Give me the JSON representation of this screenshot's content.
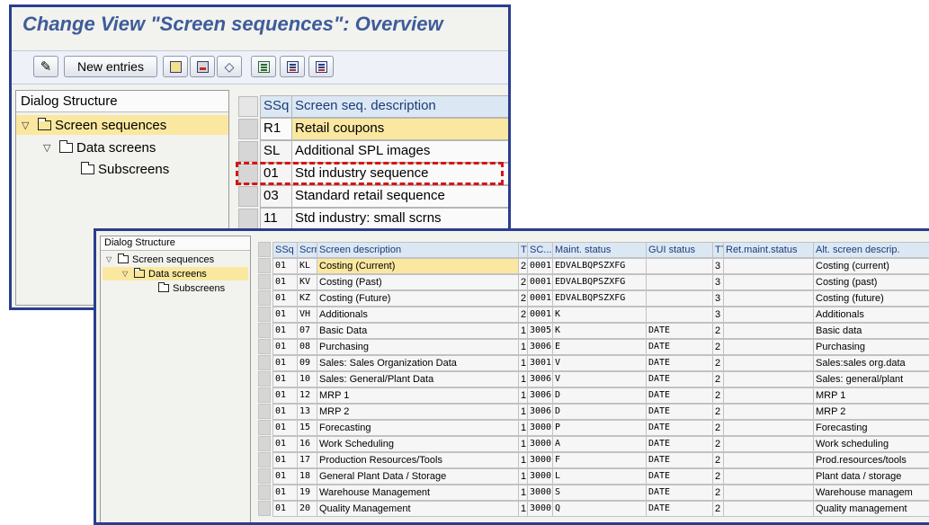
{
  "back_window": {
    "title": "Change View \"Screen sequences\": Overview",
    "toolbar": {
      "new_entries": "New entries"
    },
    "dialog": {
      "header": "Dialog Structure",
      "nodes": {
        "screen_sequences": "Screen sequences",
        "data_screens": "Data screens",
        "subscreens": "Subscreens"
      }
    },
    "table": {
      "headers": {
        "ssq": "SSq",
        "desc": "Screen seq. description"
      },
      "rows": [
        {
          "ssq": "R1",
          "desc": "Retail coupons"
        },
        {
          "ssq": "SL",
          "desc": "Additional SPL images"
        },
        {
          "ssq": "01",
          "desc": "Std industry sequence"
        },
        {
          "ssq": "03",
          "desc": "Standard retail sequence"
        },
        {
          "ssq": "11",
          "desc": "Std industry: small scrns"
        }
      ]
    }
  },
  "front_window": {
    "dialog": {
      "header": "Dialog Structure",
      "nodes": {
        "screen_sequences": "Screen sequences",
        "data_screens": "Data screens",
        "subscreens": "Subscreens"
      }
    },
    "table": {
      "headers": {
        "ssq": "SSq",
        "scrn": "Scrn",
        "desc": "Screen description",
        "t": "T",
        "sc": "SC...",
        "maint": "Maint. status",
        "gui": "GUI status",
        "tt": "TT",
        "ret": "Ret.maint.status",
        "alt": "Alt. screen descrip."
      },
      "rows": [
        {
          "ssq": "01",
          "scrn": "KL",
          "desc": "Costing (Current)",
          "t": "2",
          "sc": "0001",
          "maint": "EDVALBQPSZXFG",
          "gui": "",
          "tt": "3",
          "ret": "",
          "alt": "Costing (current)"
        },
        {
          "ssq": "01",
          "scrn": "KV",
          "desc": "Costing (Past)",
          "t": "2",
          "sc": "0001",
          "maint": "EDVALBQPSZXFG",
          "gui": "",
          "tt": "3",
          "ret": "",
          "alt": "Costing (past)"
        },
        {
          "ssq": "01",
          "scrn": "KZ",
          "desc": "Costing (Future)",
          "t": "2",
          "sc": "0001",
          "maint": "EDVALBQPSZXFG",
          "gui": "",
          "tt": "3",
          "ret": "",
          "alt": "Costing (future)"
        },
        {
          "ssq": "01",
          "scrn": "VH",
          "desc": "Additionals",
          "t": "2",
          "sc": "0001",
          "maint": "K",
          "gui": "",
          "tt": "3",
          "ret": "",
          "alt": "Additionals"
        },
        {
          "ssq": "01",
          "scrn": "07",
          "desc": "Basic Data",
          "t": "1",
          "sc": "3005",
          "maint": "K",
          "gui": "DATE",
          "tt": "2",
          "ret": "",
          "alt": "Basic data"
        },
        {
          "ssq": "01",
          "scrn": "08",
          "desc": "Purchasing",
          "t": "1",
          "sc": "3006",
          "maint": "E",
          "gui": "DATE",
          "tt": "2",
          "ret": "",
          "alt": "Purchasing"
        },
        {
          "ssq": "01",
          "scrn": "09",
          "desc": "Sales: Sales Organization Data",
          "t": "1",
          "sc": "3001",
          "maint": "V",
          "gui": "DATE",
          "tt": "2",
          "ret": "",
          "alt": "Sales:sales org.data"
        },
        {
          "ssq": "01",
          "scrn": "10",
          "desc": "Sales: General/Plant Data",
          "t": "1",
          "sc": "3006",
          "maint": "V",
          "gui": "DATE",
          "tt": "2",
          "ret": "",
          "alt": "Sales: general/plant"
        },
        {
          "ssq": "01",
          "scrn": "12",
          "desc": "MRP 1",
          "t": "1",
          "sc": "3006",
          "maint": "D",
          "gui": "DATE",
          "tt": "2",
          "ret": "",
          "alt": "MRP 1"
        },
        {
          "ssq": "01",
          "scrn": "13",
          "desc": "MRP 2",
          "t": "1",
          "sc": "3006",
          "maint": "D",
          "gui": "DATE",
          "tt": "2",
          "ret": "",
          "alt": "MRP 2"
        },
        {
          "ssq": "01",
          "scrn": "15",
          "desc": "Forecasting",
          "t": "1",
          "sc": "3000",
          "maint": "P",
          "gui": "DATE",
          "tt": "2",
          "ret": "",
          "alt": "Forecasting"
        },
        {
          "ssq": "01",
          "scrn": "16",
          "desc": "Work Scheduling",
          "t": "1",
          "sc": "3000",
          "maint": "A",
          "gui": "DATE",
          "tt": "2",
          "ret": "",
          "alt": "Work scheduling"
        },
        {
          "ssq": "01",
          "scrn": "17",
          "desc": "Production Resources/Tools",
          "t": "1",
          "sc": "3000",
          "maint": "F",
          "gui": "DATE",
          "tt": "2",
          "ret": "",
          "alt": "Prod.resources/tools"
        },
        {
          "ssq": "01",
          "scrn": "18",
          "desc": "General Plant Data / Storage",
          "t": "1",
          "sc": "3000",
          "maint": "L",
          "gui": "DATE",
          "tt": "2",
          "ret": "",
          "alt": "Plant data / storage"
        },
        {
          "ssq": "01",
          "scrn": "19",
          "desc": "Warehouse Management",
          "t": "1",
          "sc": "3000",
          "maint": "S",
          "gui": "DATE",
          "tt": "2",
          "ret": "",
          "alt": "Warehouse managem"
        },
        {
          "ssq": "01",
          "scrn": "20",
          "desc": "Quality Management",
          "t": "1",
          "sc": "3000",
          "maint": "Q",
          "gui": "DATE",
          "tt": "2",
          "ret": "",
          "alt": "Quality management"
        }
      ]
    }
  }
}
